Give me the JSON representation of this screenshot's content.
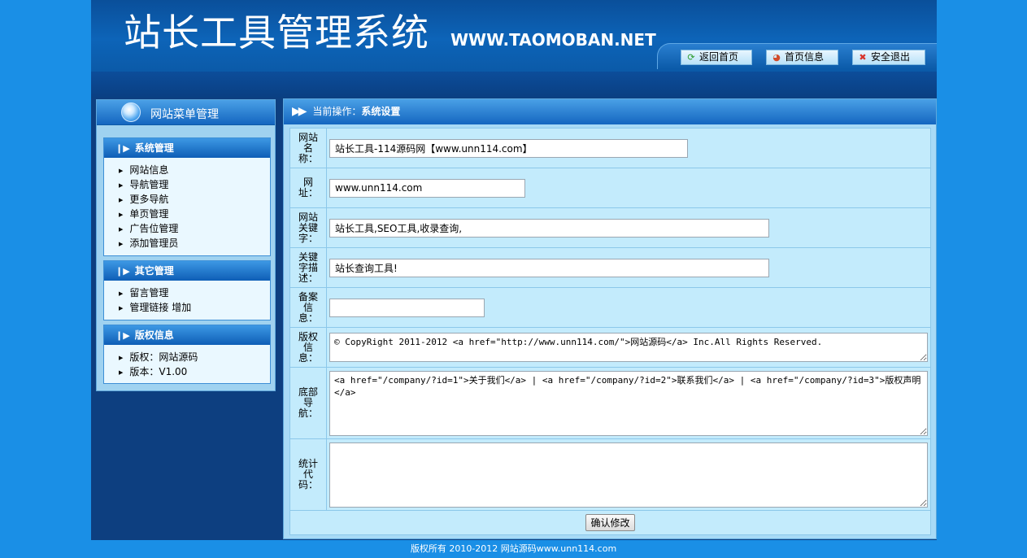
{
  "header": {
    "logo_cn": "站长工具管理系统",
    "logo_en": "WWW.TAOMOBAN.NET",
    "buttons": [
      {
        "label": "返回首页",
        "icon": "refresh-icon"
      },
      {
        "label": "首页信息",
        "icon": "pie-chart-icon"
      },
      {
        "label": "安全退出",
        "icon": "close-icon"
      }
    ]
  },
  "sidebar": {
    "title": "网站菜单管理",
    "groups": [
      {
        "title": "系统管理",
        "items": [
          "网站信息",
          "导航管理",
          "更多导航",
          "单页管理",
          "广告位管理",
          "添加管理员"
        ]
      },
      {
        "title": "其它管理",
        "items": [
          "留言管理",
          "管理链接",
          "增加"
        ]
      },
      {
        "title": "版权信息",
        "items": [
          "版权：网站源码",
          "版本：V1.00"
        ]
      }
    ]
  },
  "main": {
    "breadcrumb_prefix": "当前操作：",
    "breadcrumb_current": "系统设置",
    "fields": [
      {
        "label": "网站名称：",
        "value": "站长工具-114源码网【www.unn114.com】"
      },
      {
        "label": "网址：",
        "value": "www.unn114.com"
      },
      {
        "label": "网站关键字：",
        "value": "站长工具,SEO工具,收录查询,"
      },
      {
        "label": "关键字描述：",
        "value": "站长查询工具!"
      },
      {
        "label": "备案信息：",
        "value": ""
      },
      {
        "label": "版权信息：",
        "value": "© CopyRight 2011-2012 <a href=\"http://www.unn114.com/\">网站源码</a> Inc.All Rights Reserved."
      },
      {
        "label": "底部导航：",
        "value": "<a href=\"/company/?id=1\">关于我们</a> | <a href=\"/company/?id=2\">联系我们</a> | <a href=\"/company/?id=3\">版权声明</a>"
      },
      {
        "label": "统计代码：",
        "value": ""
      }
    ],
    "submit_label": "确认修改"
  },
  "footer": {
    "text": "版权所有 2010-2012 网站源码www.unn114.com"
  },
  "colors": {
    "page_background": "#1a8fe6",
    "header_blue": "#0d64b8",
    "panel_background": "#a8daf6",
    "form_background": "#c3ebfc"
  }
}
